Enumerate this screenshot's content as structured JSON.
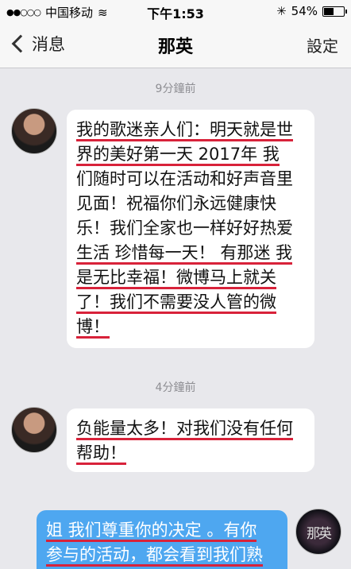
{
  "status_bar": {
    "carrier": "中国移动",
    "time": "下午1:53",
    "battery": "54%",
    "battery_level": 0.54
  },
  "nav": {
    "back_label": "消息",
    "title": "那英",
    "settings_label": "設定"
  },
  "conversation": {
    "timestamp_1": "9分鐘前",
    "message_1_lines": [
      "我的歌迷亲人们：明天就是世",
      "界的美好第一天  2017年 我",
      "们随时可以在活动和好声音里",
      "见面！祝福你们永远健康快",
      "乐！我们全家也一样好好热爱",
      "生活 珍惜每一天！ 有那迷 我",
      "是无比幸福！微博马上就关",
      "了！我们不需要没人管的微",
      "博！"
    ],
    "timestamp_2": "4分鐘前",
    "message_2_lines": [
      "负能量太多！对我们没有任何",
      "帮助！"
    ],
    "message_3_lines": [
      "姐 我们尊重你的决定 。有你",
      "参与的活动，都会看到我们熟"
    ],
    "my_avatar_text": "那英"
  }
}
